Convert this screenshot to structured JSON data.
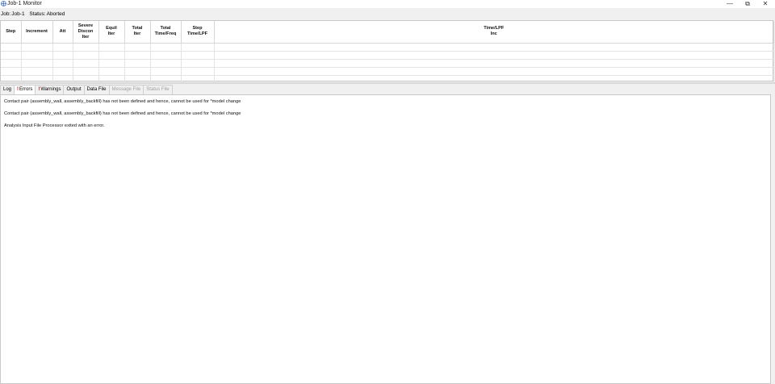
{
  "window": {
    "title": "Job-1 Monitor",
    "controls": {
      "minimize": "—",
      "maximize": "⧉",
      "close": "✕"
    }
  },
  "job": {
    "label": "Job:",
    "name": "Job-1",
    "status_label": "Status:",
    "status": "Aborted"
  },
  "grid": {
    "columns": [
      "Step",
      "Increment",
      "Att",
      "Severe\nDiscon\nIter",
      "Equil\nIter",
      "Total\nIter",
      "Total\nTime/Freq",
      "Step\nTime/LPF",
      "Time/LPF\nInc"
    ],
    "rows": [
      [],
      [],
      [],
      [],
      []
    ]
  },
  "tabs": [
    {
      "label": "Log",
      "marker": "",
      "state": "normal"
    },
    {
      "label": "Errors",
      "marker": "!",
      "state": "active"
    },
    {
      "label": "Warnings",
      "marker": "!",
      "state": "normal"
    },
    {
      "label": "Output",
      "marker": "",
      "state": "normal"
    },
    {
      "label": "Data File",
      "marker": "",
      "state": "normal"
    },
    {
      "label": "Message File",
      "marker": "",
      "state": "disabled"
    },
    {
      "label": "Status File",
      "marker": "",
      "state": "disabled"
    }
  ],
  "messages": [
    "Contact pair (assembly_wall, assembly_backfill) has not been defined and hence, cannot be used for *model change",
    "Contact pair (assembly_wall, assembly_backfill) has not been defined and hence, cannot be used for *model change",
    "Analysis Input File Processor exited with an error."
  ],
  "colors": {
    "error_marker": "#d00000",
    "disabled_text": "#a0a0a0",
    "app_icon": "#4a78c8"
  }
}
